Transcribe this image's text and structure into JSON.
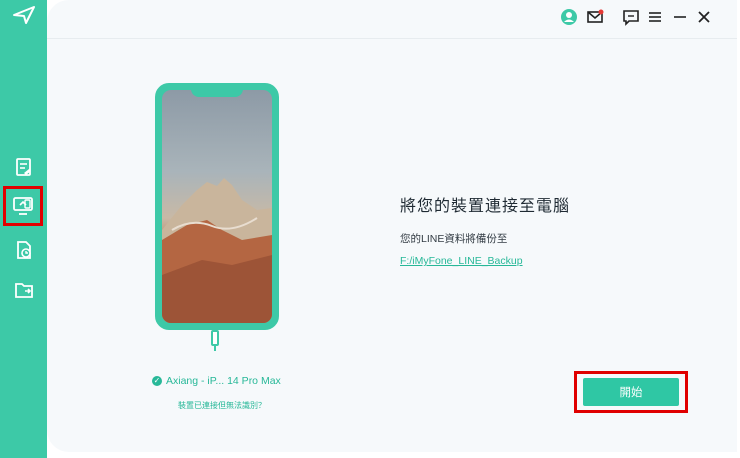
{
  "colors": {
    "brand": "#3dc9a7",
    "accent_text": "#27b898",
    "highlight": "#e00000",
    "background": "#f6f9fb"
  },
  "sidebar": {
    "logo": "app-logo-icon",
    "items": [
      {
        "icon": "document-icon",
        "active": false
      },
      {
        "icon": "device-to-pc-icon",
        "active": true
      },
      {
        "icon": "restore-icon",
        "active": false
      },
      {
        "icon": "folder-export-icon",
        "active": false
      }
    ]
  },
  "titlebar": {
    "icons": [
      "user-icon",
      "mail-icon",
      "feedback-icon",
      "menu-icon",
      "minimize-icon",
      "close-icon"
    ]
  },
  "device": {
    "name": "Axiang - iP... 14 Pro Max",
    "unrecognized_link": "裝置已連接但無法識別？"
  },
  "main": {
    "title": "將您的裝置連接至電腦",
    "subtitle": "您的LINE資料將備份至",
    "backup_path": "F:/iMyFone_LINE_Backup",
    "start_label": "開始"
  }
}
